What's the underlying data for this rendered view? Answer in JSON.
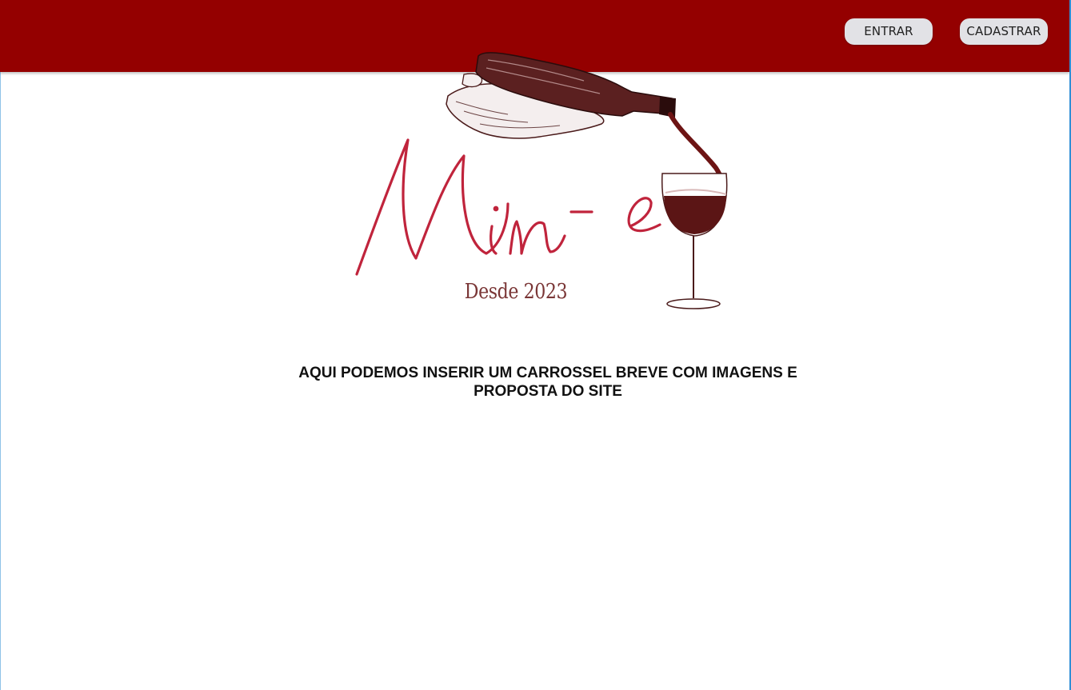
{
  "header": {
    "background_color": "#940000",
    "login_label": "ENTRAR",
    "signup_label": "CADASTRAR"
  },
  "brand": {
    "name": "Win - e",
    "since": "Desde 2023",
    "script_color": "#c0243c",
    "illustration_color": "#4a1a1a"
  },
  "main": {
    "carousel_placeholder": "AQUI PODEMOS INSERIR UM  CARROSSEL BREVE COM IMAGENS E PROPOSTA DO SITE"
  }
}
